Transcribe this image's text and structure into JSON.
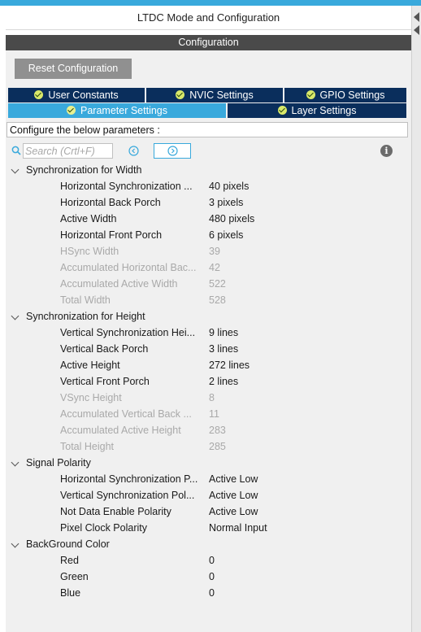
{
  "header": {
    "title": "LTDC Mode and Configuration"
  },
  "configuration": {
    "label": "Configuration"
  },
  "toolbar": {
    "reset_label": "Reset Configuration"
  },
  "tabs": [
    {
      "label": "User Constants",
      "active": false
    },
    {
      "label": "NVIC Settings",
      "active": false
    },
    {
      "label": "GPIO Settings",
      "active": false
    },
    {
      "label": "Parameter Settings",
      "active": true
    },
    {
      "label": "Layer Settings",
      "active": false
    }
  ],
  "configure_label": "Configure the below parameters :",
  "search": {
    "placeholder": "Search (Crtl+F)"
  },
  "colors": {
    "accent": "#39a9dc",
    "tab_dark": "#0a2e5c",
    "header_bar": "#4a4a4a",
    "disabled_text": "#a9a9a9"
  },
  "icons": [
    "search-icon",
    "chevron-left-circle-icon",
    "chevron-right-circle-icon",
    "info-icon",
    "check-circle-icon",
    "chevron-down-icon"
  ],
  "groups": [
    {
      "label": "Synchronization for Width",
      "params": [
        {
          "name": "Horizontal Synchronization ...",
          "value": "40 pixels",
          "enabled": true
        },
        {
          "name": "Horizontal Back Porch",
          "value": "3 pixels",
          "enabled": true
        },
        {
          "name": "Active Width",
          "value": "480 pixels",
          "enabled": true
        },
        {
          "name": "Horizontal Front Porch",
          "value": "6 pixels",
          "enabled": true
        },
        {
          "name": "HSync Width",
          "value": "39",
          "enabled": false
        },
        {
          "name": "Accumulated Horizontal Bac...",
          "value": "42",
          "enabled": false
        },
        {
          "name": "Accumulated Active Width",
          "value": "522",
          "enabled": false
        },
        {
          "name": "Total Width",
          "value": "528",
          "enabled": false
        }
      ]
    },
    {
      "label": "Synchronization for Height",
      "params": [
        {
          "name": "Vertical Synchronization Hei...",
          "value": "9 lines",
          "enabled": true
        },
        {
          "name": "Vertical Back Porch",
          "value": "3 lines",
          "enabled": true
        },
        {
          "name": "Active Height",
          "value": "272 lines",
          "enabled": true
        },
        {
          "name": "Vertical Front Porch",
          "value": "2 lines",
          "enabled": true
        },
        {
          "name": "VSync Height",
          "value": "8",
          "enabled": false
        },
        {
          "name": "Accumulated Vertical Back ...",
          "value": "11",
          "enabled": false
        },
        {
          "name": "Accumulated Active Height",
          "value": "283",
          "enabled": false
        },
        {
          "name": "Total Height",
          "value": "285",
          "enabled": false
        }
      ]
    },
    {
      "label": "Signal Polarity",
      "params": [
        {
          "name": "Horizontal Synchronization P...",
          "value": "Active Low",
          "enabled": true
        },
        {
          "name": "Vertical Synchronization Pol...",
          "value": "Active Low",
          "enabled": true
        },
        {
          "name": "Not Data Enable Polarity",
          "value": "Active Low",
          "enabled": true
        },
        {
          "name": "Pixel Clock Polarity",
          "value": "Normal Input",
          "enabled": true
        }
      ]
    },
    {
      "label": "BackGround Color",
      "params": [
        {
          "name": "Red",
          "value": "0",
          "enabled": true
        },
        {
          "name": "Green",
          "value": "0",
          "enabled": true
        },
        {
          "name": "Blue",
          "value": "0",
          "enabled": true
        }
      ]
    }
  ]
}
